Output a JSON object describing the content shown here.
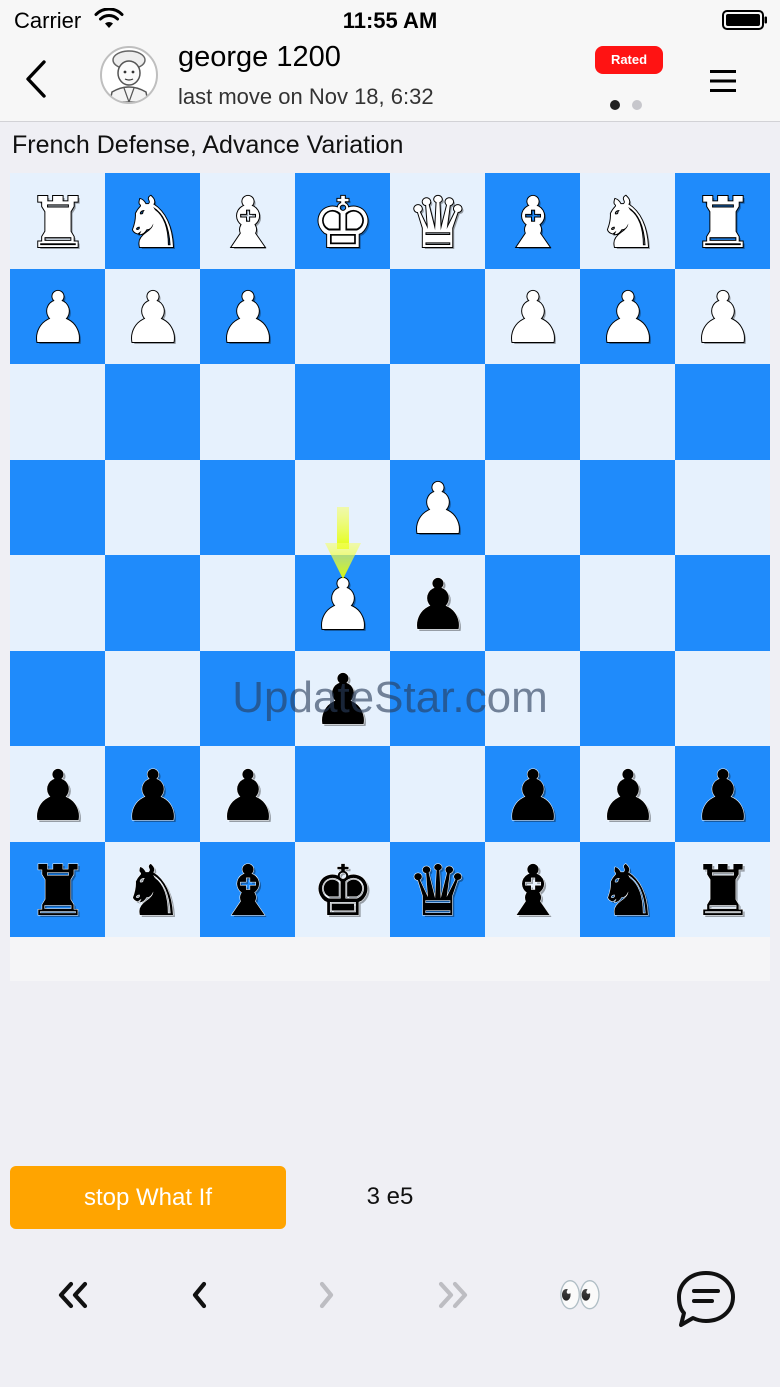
{
  "status_bar": {
    "carrier": "Carrier",
    "time": "11:55 AM"
  },
  "header": {
    "player_name": "george 1200",
    "last_move": "last move on Nov 18, 6:32",
    "rated_badge": "Rated",
    "back_icon": "chevron-left-icon",
    "menu_icon": "hamburger-menu-icon",
    "pages": 2,
    "active_page": 0
  },
  "opening": "French Defense, Advance Variation",
  "board": {
    "light_color": "#e6f1fd",
    "dark_color": "#1f8bfb",
    "rows": [
      [
        "wR",
        "wN",
        "wB",
        "wK",
        "wQ",
        "wB",
        "wN",
        "wR"
      ],
      [
        "wP",
        "wP",
        "wP",
        "",
        "",
        "wP",
        "wP",
        "wP"
      ],
      [
        "",
        "",
        "",
        "",
        "",
        "",
        "",
        ""
      ],
      [
        "",
        "",
        "",
        "",
        "wP",
        "",
        "",
        ""
      ],
      [
        "",
        "",
        "",
        "wP",
        "bP",
        "",
        "",
        ""
      ],
      [
        "",
        "",
        "",
        "bP",
        "",
        "",
        "",
        ""
      ],
      [
        "bP",
        "bP",
        "bP",
        "",
        "",
        "bP",
        "bP",
        "bP"
      ],
      [
        "bR",
        "bN",
        "bB",
        "bK",
        "bQ",
        "bB",
        "bN",
        "bR"
      ]
    ],
    "last_move_arrow_color": "#e8ff1a"
  },
  "watermark": "UpdateStar.com",
  "controls": {
    "what_if_button": "stop What If",
    "what_if_color": "#ffa400",
    "move_label": "3 e5",
    "first_icon": "double-chevron-left-icon",
    "prev_icon": "chevron-left-icon",
    "next_icon": "chevron-right-icon",
    "last_icon": "double-chevron-right-icon",
    "eyes_icon": "👀",
    "chat_icon": "chat-bubble-icon"
  }
}
